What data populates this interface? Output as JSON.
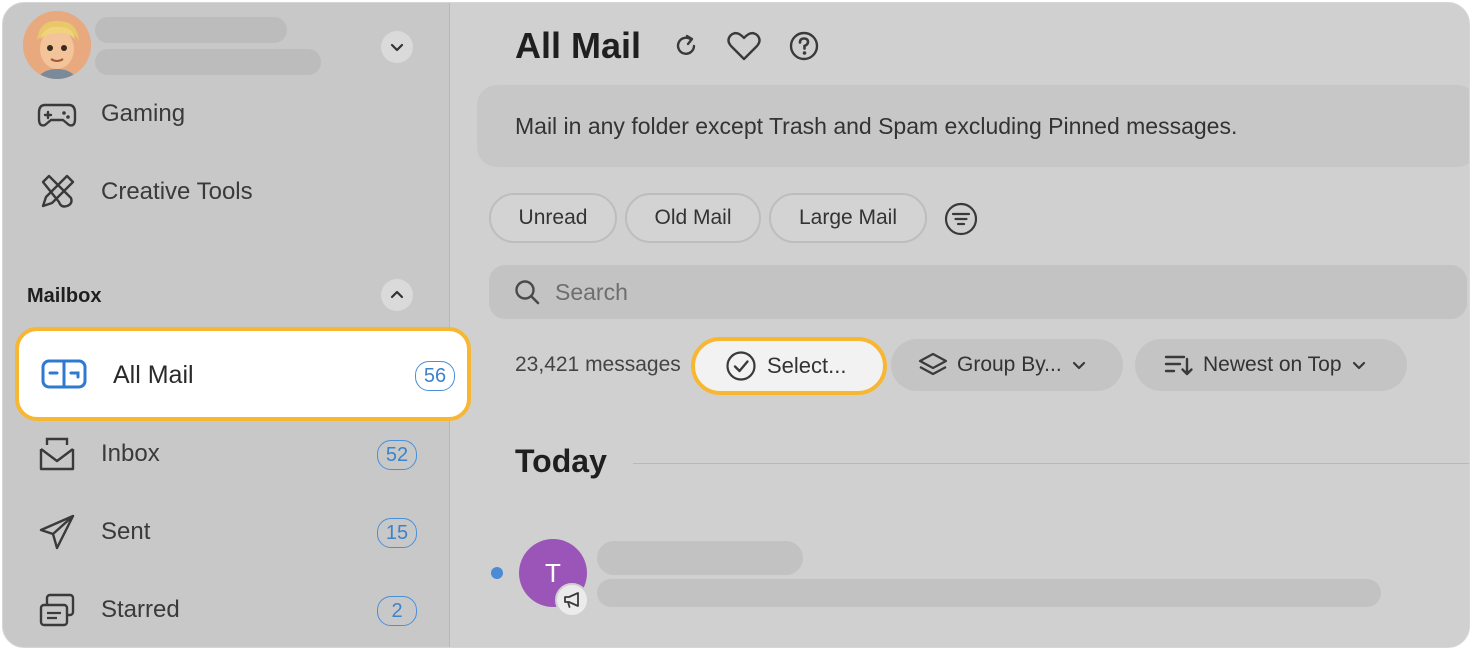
{
  "sidebar": {
    "items_top": [
      {
        "label": "Gaming",
        "icon": "gamepad-icon"
      },
      {
        "label": "Creative Tools",
        "icon": "creative-tools-icon"
      }
    ],
    "section_title": "Mailbox",
    "mailbox": [
      {
        "label": "All Mail",
        "count": "56",
        "icon": "all-mail-icon"
      },
      {
        "label": "Inbox",
        "count": "52",
        "icon": "inbox-icon"
      },
      {
        "label": "Sent",
        "count": "15",
        "icon": "sent-icon"
      },
      {
        "label": "Starred",
        "count": "2",
        "icon": "starred-icon"
      }
    ]
  },
  "header": {
    "title": "All Mail"
  },
  "description": "Mail in any folder except Trash and Spam excluding Pinned messages.",
  "filters": [
    "Unread",
    "Old Mail",
    "Large Mail"
  ],
  "search": {
    "placeholder": "Search"
  },
  "toolbar": {
    "message_count": "23,421 messages",
    "select_label": "Select...",
    "group_label": "Group By...",
    "sort_label": "Newest on Top"
  },
  "list": {
    "section": "Today",
    "messages": [
      {
        "avatar_initial": "T",
        "unread": true
      }
    ]
  },
  "colors": {
    "accent": "#4a90d9",
    "highlight": "#f7b733",
    "avatar_bg": "#9b55b8"
  }
}
